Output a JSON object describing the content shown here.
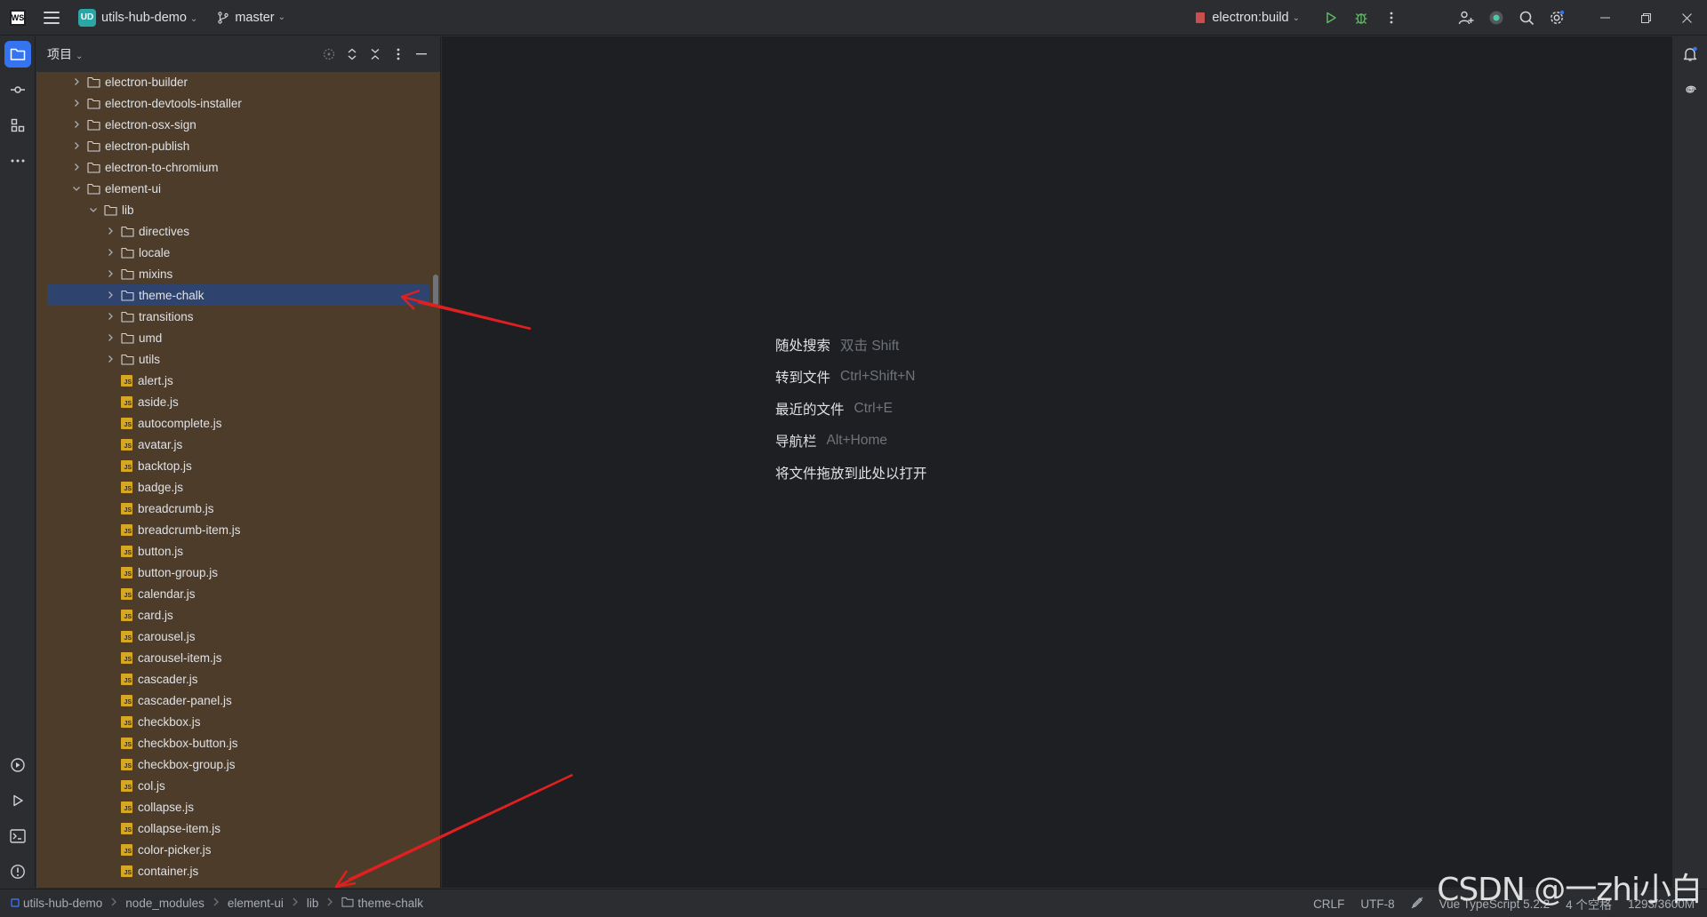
{
  "titlebar": {
    "project_badge": "UD",
    "project_name": "utils-hub-demo",
    "branch": "master",
    "run_config": "electron:build"
  },
  "panel": {
    "title": "项目"
  },
  "tree": {
    "rows": [
      {
        "label": "electron-builder",
        "indent": 2,
        "kind": "folder",
        "expand": "collapsed"
      },
      {
        "label": "electron-devtools-installer",
        "indent": 2,
        "kind": "folder",
        "expand": "collapsed"
      },
      {
        "label": "electron-osx-sign",
        "indent": 2,
        "kind": "folder",
        "expand": "collapsed"
      },
      {
        "label": "electron-publish",
        "indent": 2,
        "kind": "folder",
        "expand": "collapsed"
      },
      {
        "label": "electron-to-chromium",
        "indent": 2,
        "kind": "folder",
        "expand": "collapsed"
      },
      {
        "label": "element-ui",
        "indent": 2,
        "kind": "folder",
        "expand": "expanded"
      },
      {
        "label": "lib",
        "indent": 3,
        "kind": "folder",
        "expand": "expanded"
      },
      {
        "label": "directives",
        "indent": 4,
        "kind": "folder",
        "expand": "collapsed"
      },
      {
        "label": "locale",
        "indent": 4,
        "kind": "folder",
        "expand": "collapsed"
      },
      {
        "label": "mixins",
        "indent": 4,
        "kind": "folder",
        "expand": "collapsed"
      },
      {
        "label": "theme-chalk",
        "indent": 4,
        "kind": "folder",
        "expand": "collapsed",
        "selected": true
      },
      {
        "label": "transitions",
        "indent": 4,
        "kind": "folder",
        "expand": "collapsed"
      },
      {
        "label": "umd",
        "indent": 4,
        "kind": "folder",
        "expand": "collapsed"
      },
      {
        "label": "utils",
        "indent": 4,
        "kind": "folder",
        "expand": "collapsed"
      },
      {
        "label": "alert.js",
        "indent": 4,
        "kind": "js",
        "expand": "none"
      },
      {
        "label": "aside.js",
        "indent": 4,
        "kind": "js",
        "expand": "none"
      },
      {
        "label": "autocomplete.js",
        "indent": 4,
        "kind": "js",
        "expand": "none"
      },
      {
        "label": "avatar.js",
        "indent": 4,
        "kind": "js",
        "expand": "none"
      },
      {
        "label": "backtop.js",
        "indent": 4,
        "kind": "js",
        "expand": "none"
      },
      {
        "label": "badge.js",
        "indent": 4,
        "kind": "js",
        "expand": "none"
      },
      {
        "label": "breadcrumb.js",
        "indent": 4,
        "kind": "js",
        "expand": "none"
      },
      {
        "label": "breadcrumb-item.js",
        "indent": 4,
        "kind": "js",
        "expand": "none"
      },
      {
        "label": "button.js",
        "indent": 4,
        "kind": "js",
        "expand": "none"
      },
      {
        "label": "button-group.js",
        "indent": 4,
        "kind": "js",
        "expand": "none"
      },
      {
        "label": "calendar.js",
        "indent": 4,
        "kind": "js",
        "expand": "none"
      },
      {
        "label": "card.js",
        "indent": 4,
        "kind": "js",
        "expand": "none"
      },
      {
        "label": "carousel.js",
        "indent": 4,
        "kind": "js",
        "expand": "none"
      },
      {
        "label": "carousel-item.js",
        "indent": 4,
        "kind": "js",
        "expand": "none"
      },
      {
        "label": "cascader.js",
        "indent": 4,
        "kind": "js",
        "expand": "none"
      },
      {
        "label": "cascader-panel.js",
        "indent": 4,
        "kind": "js",
        "expand": "none"
      },
      {
        "label": "checkbox.js",
        "indent": 4,
        "kind": "js",
        "expand": "none"
      },
      {
        "label": "checkbox-button.js",
        "indent": 4,
        "kind": "js",
        "expand": "none"
      },
      {
        "label": "checkbox-group.js",
        "indent": 4,
        "kind": "js",
        "expand": "none"
      },
      {
        "label": "col.js",
        "indent": 4,
        "kind": "js",
        "expand": "none"
      },
      {
        "label": "collapse.js",
        "indent": 4,
        "kind": "js",
        "expand": "none"
      },
      {
        "label": "collapse-item.js",
        "indent": 4,
        "kind": "js",
        "expand": "none"
      },
      {
        "label": "color-picker.js",
        "indent": 4,
        "kind": "js",
        "expand": "none"
      },
      {
        "label": "container.js",
        "indent": 4,
        "kind": "js",
        "expand": "none"
      }
    ]
  },
  "editor": {
    "hints": [
      {
        "label": "随处搜索",
        "shortcut": "双击 Shift"
      },
      {
        "label": "转到文件",
        "shortcut": "Ctrl+Shift+N"
      },
      {
        "label": "最近的文件",
        "shortcut": "Ctrl+E"
      },
      {
        "label": "导航栏",
        "shortcut": "Alt+Home"
      },
      {
        "label": "将文件拖放到此处以打开",
        "shortcut": ""
      }
    ]
  },
  "statusbar": {
    "breadcrumbs": [
      "utils-hub-demo",
      "node_modules",
      "element-ui",
      "lib",
      "theme-chalk"
    ],
    "line_ending": "CRLF",
    "encoding": "UTF-8",
    "language": "Vue TypeScript 5.2.2",
    "indent": "4 个空格",
    "memory": "1293/3600M"
  },
  "watermark": "CSDN @一zhi小白",
  "colors": {
    "selected_row": "#2e436e",
    "panel_bg": "#4d3c2a",
    "accent": "#3574f0",
    "annotation_arrow": "#e02020"
  }
}
